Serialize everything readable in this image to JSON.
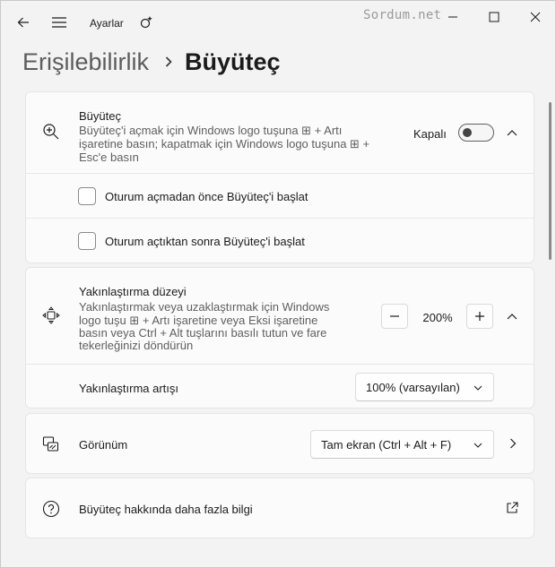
{
  "window": {
    "title": "Ayarlar",
    "watermark": "Sordum.net"
  },
  "breadcrumb": {
    "parent": "Erişilebilirlik",
    "current": "Büyüteç"
  },
  "magnifier": {
    "title": "Büyüteç",
    "desc_line1": "Büyüteç'i açmak için Windows logo tuşuna ⊞ + Artı",
    "desc_line2": "işaretine basın; kapatmak için Windows logo tuşuna ⊞ +",
    "desc_line3": "Esc'e basın",
    "toggle_label": "Kapalı",
    "toggle_on": false,
    "options": [
      {
        "label": "Oturum açmadan önce Büyüteç'i başlat",
        "checked": false
      },
      {
        "label": "Oturum açtıktan sonra Büyüteç'i başlat",
        "checked": false
      }
    ]
  },
  "zoom": {
    "title": "Yakınlaştırma düzeyi",
    "desc_line1": "Yakınlaştırmak veya uzaklaştırmak için Windows",
    "desc_line2": "logo tuşu ⊞ + Artı işaretine veya Eksi işaretine",
    "desc_line3": "basın veya Ctrl + Alt tuşlarını basılı tutun ve fare",
    "desc_line4": "tekerleğinizi döndürün",
    "value": "200%",
    "increment_label": "Yakınlaştırma artışı",
    "increment_value": "100% (varsayılan)"
  },
  "view": {
    "label": "Görünüm",
    "value": "Tam ekran (Ctrl + Alt + F)"
  },
  "more_info": {
    "label": "Büyüteç hakkında daha fazla bilgi"
  },
  "icons": {
    "back": "back-arrow-icon",
    "menu": "hamburger-menu-icon",
    "settings": "settings-sparkle-icon",
    "magnifier": "magnifier-icon",
    "zoom": "zoom-move-icon",
    "view": "view-layers-icon",
    "help": "help-circle-icon",
    "external": "external-link-icon"
  }
}
